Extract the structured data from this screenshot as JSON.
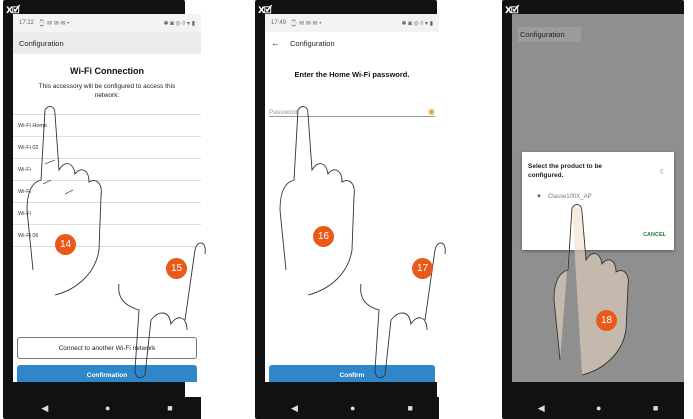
{
  "icons": {
    "camera": "camera-indicator-icon",
    "back": "arrow-left-icon",
    "eye": "eye-icon",
    "wifi": "wifi-icon",
    "spinner": "spinner-icon",
    "nav_back": "nav-back-icon",
    "nav_home": "nav-home-icon",
    "nav_recent": "nav-recent-icon"
  },
  "colors": {
    "accent_blue": "#2f86c9",
    "step_orange": "#e8591a",
    "eye_orange": "#e39a2a",
    "cancel_green": "#2a7a3a"
  },
  "phone1": {
    "status_time": "17:22",
    "status_left_icons": "⌚ ✉ ✉ ✉ •",
    "status_right_icons": "✱ ◙ ◎ ◊ ▾ ▮",
    "appbar_title": "Configuration",
    "title": "Wi-Fi Connection",
    "subtitle": "This accessory will be configured to access this network:",
    "networks": [
      "Wi-Fi Home",
      "Wi-Fi 02",
      "Wi-Fi",
      "Wi-Fi",
      "Wi-Fi",
      "Wi-Fi 06"
    ],
    "connect_other_label": "Connect to another Wi-Fi network",
    "confirm_label": "Confirmation",
    "steps": [
      "14",
      "15"
    ]
  },
  "phone2": {
    "status_time": "17:49",
    "status_left_icons": "⌚ ✉ ✉ ✉ •",
    "status_right_icons": "✱ ◙ ◎ ◊ ▾ ▮",
    "appbar_title": "Configuration",
    "title": "Enter the Home Wi-Fi password.",
    "password_placeholder": "Password",
    "confirm_label": "Confirm",
    "steps": [
      "16",
      "17"
    ]
  },
  "phone3": {
    "appbar_title": "Configuration",
    "dialog_title": "Select the product to be configured.",
    "product": "Classe100X_AP",
    "cancel_label": "CANCEL",
    "steps": [
      "18"
    ]
  },
  "nav": {
    "back": "◀",
    "home": "●",
    "recent": "■"
  },
  "camera_text": "X🗹"
}
